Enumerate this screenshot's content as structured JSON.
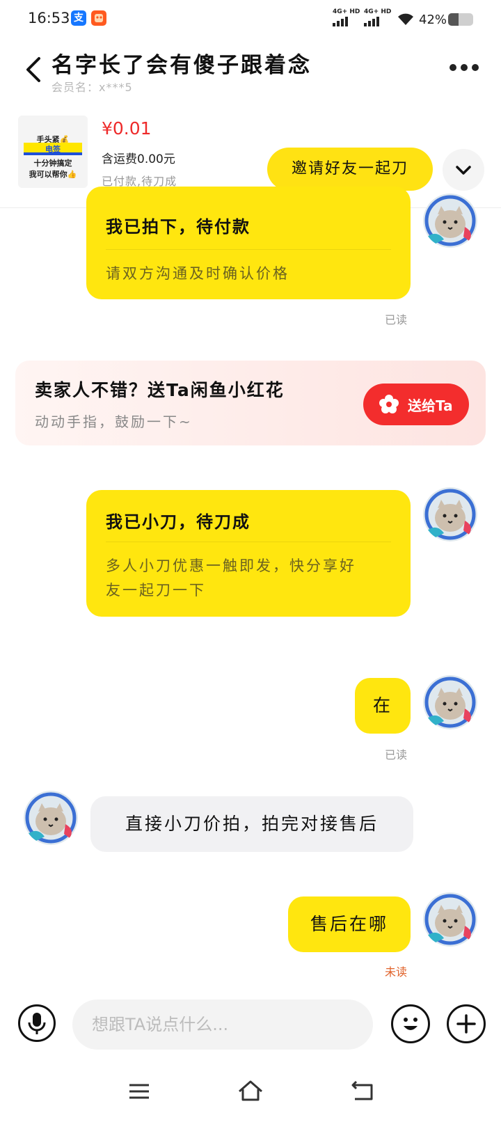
{
  "status_bar": {
    "time": "16:53",
    "app_icons": [
      "alipay-icon",
      "taobao-icon"
    ],
    "sim1": "4G+ HD",
    "sim2": "4G+ HD",
    "battery": "42%",
    "battery_level": 0.42
  },
  "header": {
    "title": "名字长了会有傻子跟着念",
    "subtitle": "会员名：x***5"
  },
  "product": {
    "thumb_lines": [
      "手头紧💰",
      "电签",
      "十分钟搞定",
      "我可以帮你👍"
    ],
    "price": "¥0.01",
    "shipping": "含运费0.00元",
    "status": "已付款,待刀成",
    "invite_label": "邀请好友一起刀"
  },
  "messages": {
    "card1": {
      "title": "我已拍下，待付款",
      "desc": "请双方沟通及时确认价格",
      "receipt": "已读"
    },
    "flower": {
      "title": "卖家人不错？送Ta闲鱼小红花",
      "subtitle": "动动手指，鼓励一下~",
      "button": "送给Ta"
    },
    "card2": {
      "title": "我已小刀，待刀成",
      "desc_line1": "多人小刀优惠一触即发，快分享好",
      "desc_line2": "友一起刀一下"
    },
    "msg_zai": {
      "text": "在",
      "receipt": "已读"
    },
    "msg_seller": {
      "text": "直接小刀价拍，拍完对接售后"
    },
    "msg_shouhou": {
      "text": "售后在哪",
      "receipt": "未读"
    }
  },
  "input_bar": {
    "placeholder": "想跟TA说点什么..."
  },
  "colors": {
    "accent_yellow": "#ffe60f",
    "price_red": "#ee2a2a",
    "flower_red": "#f32d2d",
    "unread_orange": "#e0622a"
  }
}
